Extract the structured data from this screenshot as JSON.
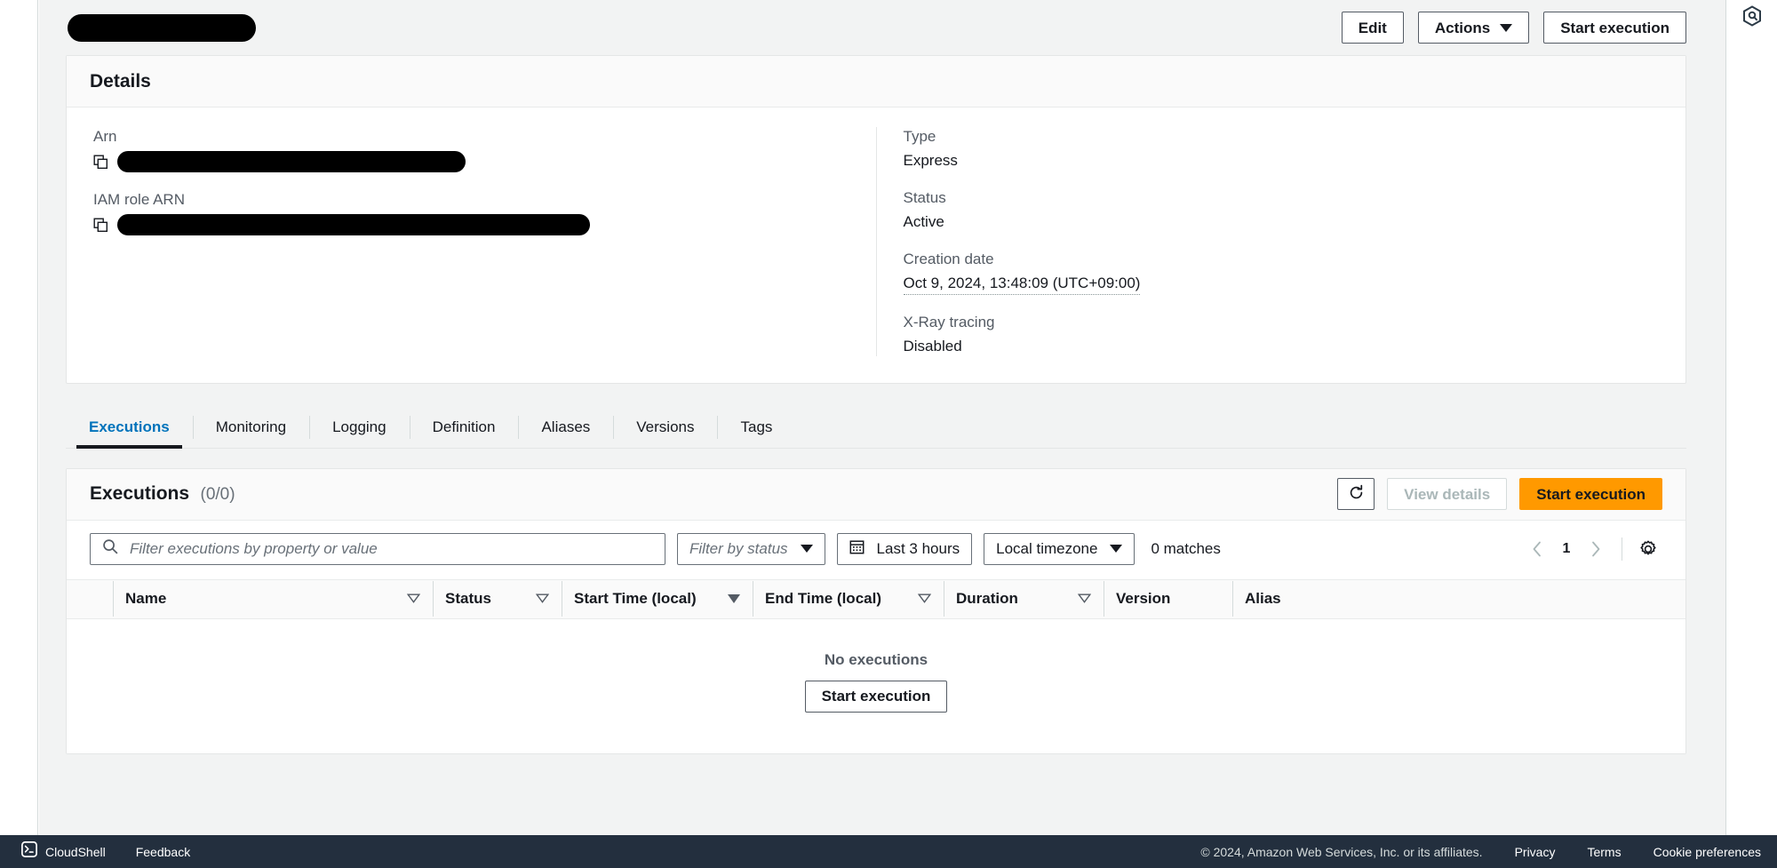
{
  "header": {
    "title": "",
    "title_redacted": true,
    "buttons": {
      "edit": "Edit",
      "actions": "Actions",
      "start_execution": "Start execution"
    }
  },
  "right_rail": {
    "icon": "help-hexagon-icon"
  },
  "details": {
    "title": "Details",
    "left_fields": [
      {
        "label": "Arn",
        "value": "",
        "redacted": true,
        "copyable": true
      },
      {
        "label": "IAM role ARN",
        "value": "",
        "redacted": true,
        "copyable": true
      }
    ],
    "right_fields": [
      {
        "label": "Type",
        "value": "Express"
      },
      {
        "label": "Status",
        "value": "Active"
      },
      {
        "label": "Creation date",
        "value": "Oct 9, 2024, 13:48:09 (UTC+09:00)"
      },
      {
        "label": "X-Ray tracing",
        "value": "Disabled"
      }
    ]
  },
  "tabs": [
    {
      "label": "Executions",
      "active": true
    },
    {
      "label": "Monitoring",
      "active": false
    },
    {
      "label": "Logging",
      "active": false
    },
    {
      "label": "Definition",
      "active": false
    },
    {
      "label": "Aliases",
      "active": false
    },
    {
      "label": "Versions",
      "active": false
    },
    {
      "label": "Tags",
      "active": false
    }
  ],
  "executions": {
    "title": "Executions",
    "count": "(0/0)",
    "refresh_icon": "refresh-icon",
    "view_details": "View details",
    "start_execution": "Start execution",
    "search": {
      "placeholder": "Filter executions by property or value",
      "value": "",
      "icon": "search-icon"
    },
    "status_filter": {
      "placeholder": "Filter by status",
      "value": ""
    },
    "time_range": {
      "label": "Last 3 hours",
      "icon": "calendar-icon"
    },
    "timezone": {
      "label": "Local timezone"
    },
    "matches": "0 matches",
    "pagination": {
      "prev_icon": "chevron-left-icon",
      "page": "1",
      "next_icon": "chevron-right-icon",
      "settings_icon": "gear-icon"
    },
    "columns": [
      {
        "label": "Name",
        "sort": "hollow"
      },
      {
        "label": "Status",
        "sort": "hollow"
      },
      {
        "label": "Start Time (local)",
        "sort": "filled"
      },
      {
        "label": "End Time (local)",
        "sort": "hollow"
      },
      {
        "label": "Duration",
        "sort": "hollow"
      },
      {
        "label": "Version",
        "sort": "none"
      },
      {
        "label": "Alias",
        "sort": "none"
      }
    ],
    "rows": [],
    "empty": {
      "title": "No executions",
      "button": "Start execution"
    }
  },
  "footer": {
    "cloudshell": "CloudShell",
    "cloudshell_icon": "cloudshell-icon",
    "feedback": "Feedback",
    "copyright": "© 2024, Amazon Web Services, Inc. or its affiliates.",
    "privacy": "Privacy",
    "terms": "Terms",
    "cookie_preferences": "Cookie preferences"
  },
  "colors": {
    "accent_orange": "#ff9900",
    "link_blue": "#0073bb",
    "footer_navy": "#232f3e",
    "page_bg": "#f2f3f3"
  }
}
